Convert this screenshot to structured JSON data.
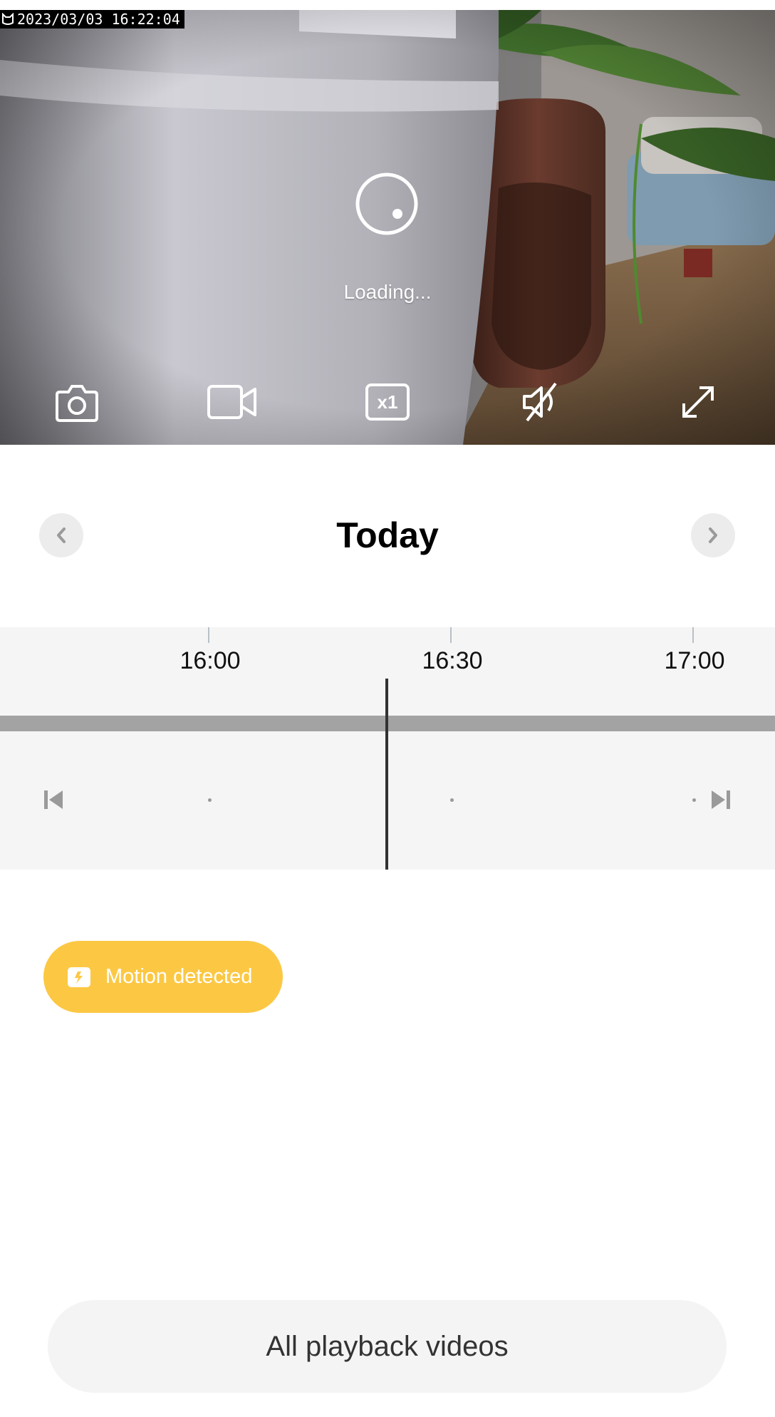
{
  "video": {
    "timestamp": "2023/03/03  16:22:04",
    "loading_text": "Loading...",
    "speed_label": "x1",
    "icons": [
      "camera-icon",
      "video-record-icon",
      "speed-icon",
      "mute-icon",
      "fullscreen-icon"
    ]
  },
  "date_nav": {
    "title": "Today"
  },
  "timeline": {
    "ticks": [
      "16:00",
      "16:30",
      "17:00"
    ]
  },
  "events": {
    "motion_label": "Motion detected",
    "motion_color": "#fcc844"
  },
  "footer": {
    "all_videos_label": "All playback videos"
  }
}
